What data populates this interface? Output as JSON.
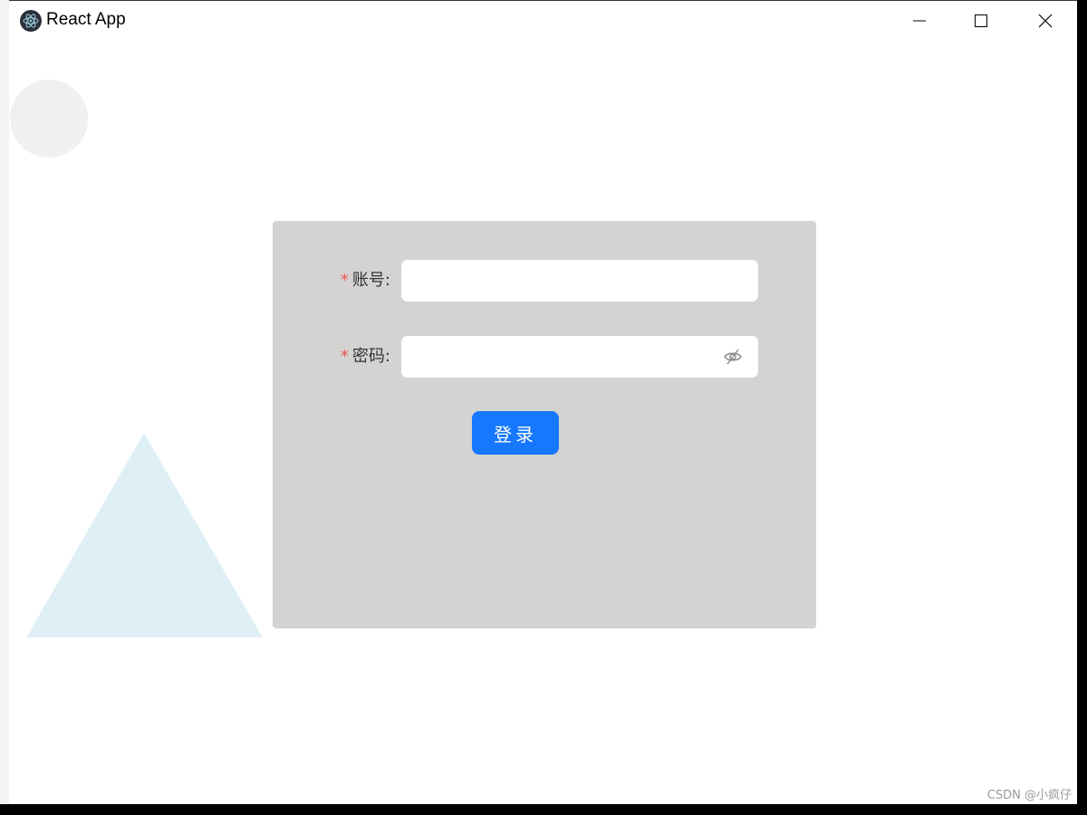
{
  "window": {
    "title": "React App",
    "icon": "electron-atom-icon"
  },
  "controls": {
    "minimize": "minimize-icon",
    "maximize": "maximize-icon",
    "close": "close-icon"
  },
  "form": {
    "account": {
      "required_mark": "*",
      "label": "账号:",
      "value": "",
      "placeholder": ""
    },
    "password": {
      "required_mark": "*",
      "label": "密码:",
      "value": "",
      "placeholder": "",
      "toggle_icon": "eye-invisible-icon"
    },
    "submit_label": "登录"
  },
  "colors": {
    "primary": "#1677ff",
    "card": "#d4d3d2",
    "required": "#f05555",
    "triangle": "#dfeff6",
    "circle": "#f0f0f0"
  },
  "watermark": "CSDN @小疯仔"
}
